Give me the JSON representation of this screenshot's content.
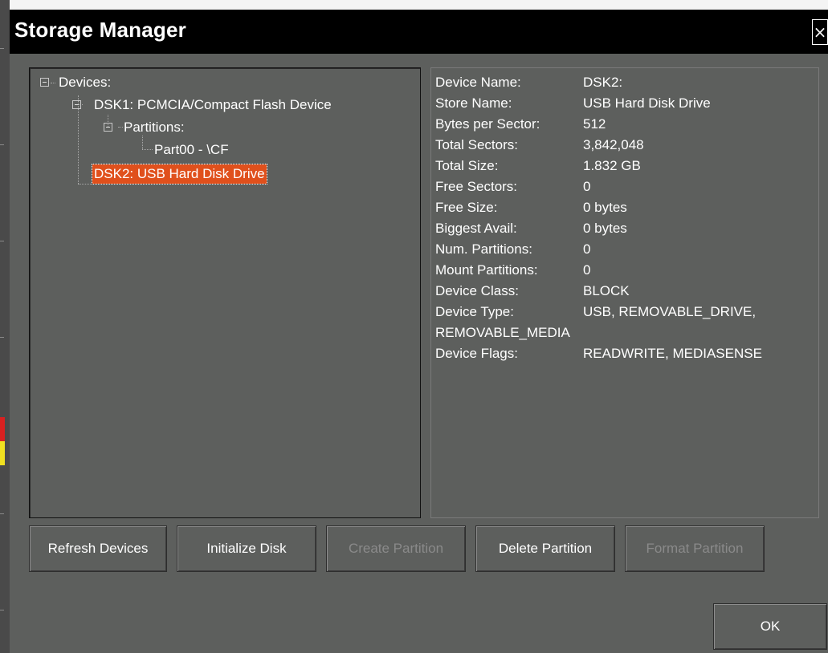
{
  "window": {
    "title": "Storage Manager",
    "close_label": "×"
  },
  "tree": {
    "root": {
      "label": "Devices:"
    },
    "dsk1": {
      "label": "DSK1: PCMCIA/Compact Flash Device"
    },
    "partitions": {
      "label": "Partitions:"
    },
    "part00": {
      "label": "Part00 - \\CF"
    },
    "dsk2": {
      "label": "DSK2: USB Hard Disk Drive",
      "selected": true
    }
  },
  "details": {
    "rows": [
      {
        "label": "Device Name:",
        "value": "DSK2:"
      },
      {
        "label": "Store Name:",
        "value": "USB Hard Disk Drive"
      },
      {
        "label": "Bytes per Sector:",
        "value": "512"
      },
      {
        "label": "Total Sectors:",
        "value": "3,842,048"
      },
      {
        "label": "Total Size:",
        "value": "1.832 GB"
      },
      {
        "label": "Free Sectors:",
        "value": "0"
      },
      {
        "label": "Free Size:",
        "value": "0 bytes"
      },
      {
        "label": "Biggest Avail:",
        "value": "0 bytes"
      },
      {
        "label": "Num. Partitions:",
        "value": "0"
      },
      {
        "label": "Mount Partitions:",
        "value": "0"
      },
      {
        "label": "Device Class:",
        "value": "BLOCK"
      },
      {
        "label": "Device Type:",
        "value": "USB, REMOVABLE_DRIVE,"
      }
    ],
    "device_type_cont": "REMOVABLE_MEDIA",
    "device_flags": {
      "label": "Device Flags:",
      "value": "READWRITE, MEDIASENSE"
    }
  },
  "buttons": {
    "refresh": "Refresh Devices",
    "initialize": "Initialize Disk",
    "create": "Create Partition",
    "delete": "Delete Partition",
    "format": "Format Partition",
    "ok": "OK"
  },
  "colors": {
    "dialog_bg": "#5d5f5d",
    "titlebar_bg": "#000000",
    "selection": "#e0501c"
  }
}
